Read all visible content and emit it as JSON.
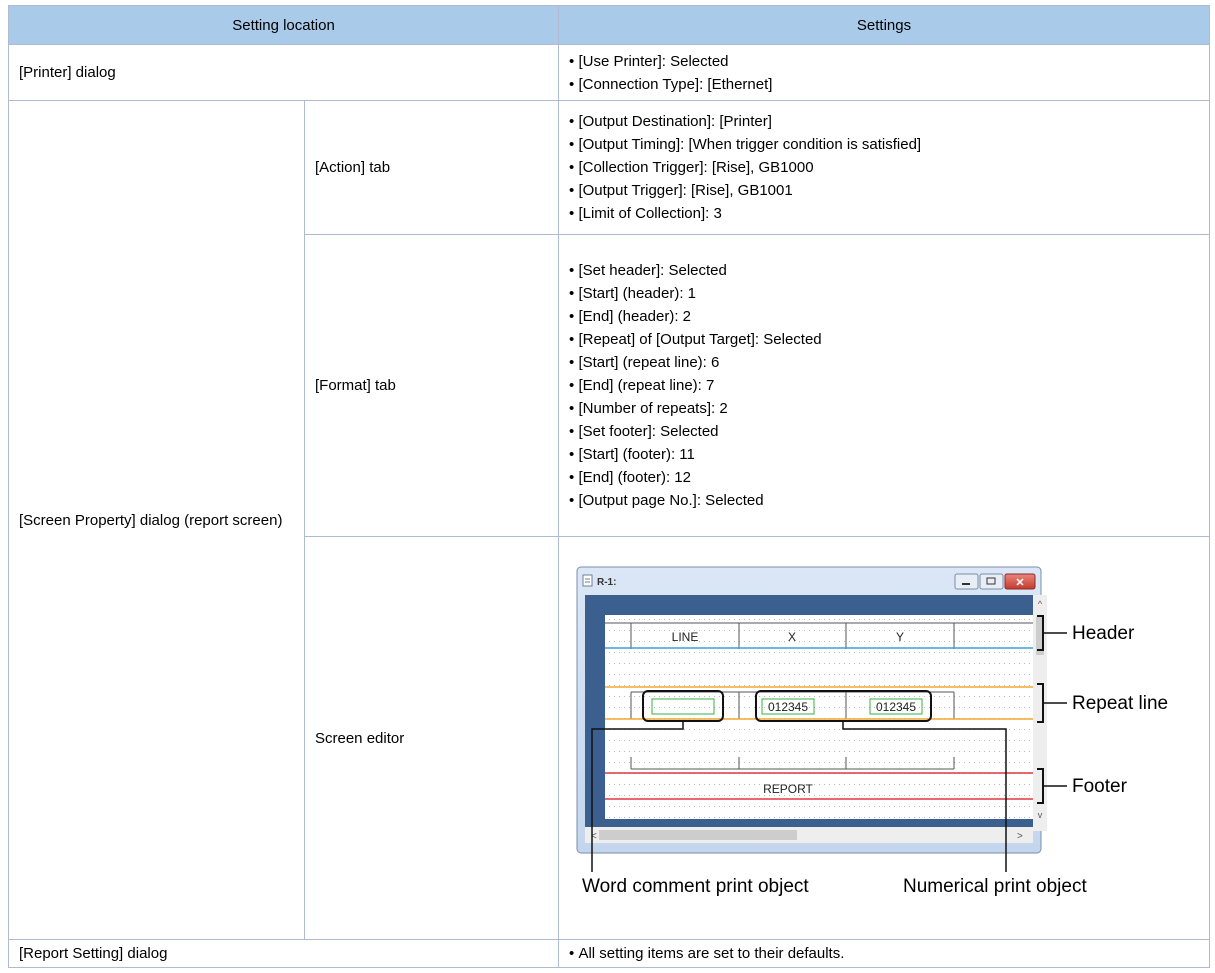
{
  "headers": {
    "location": "Setting location",
    "settings": "Settings"
  },
  "printer_row": {
    "location": "[Printer] dialog",
    "settings": [
      "[Use Printer]: Selected",
      "[Connection Type]: [Ethernet]"
    ]
  },
  "screen_property": {
    "location": "[Screen Property] dialog (report screen)",
    "action_tab": {
      "label": "[Action] tab",
      "settings": [
        "[Output Destination]: [Printer]",
        "[Output Timing]: [When trigger condition is satisfied]",
        "[Collection Trigger]: [Rise], GB1000",
        "[Output Trigger]: [Rise], GB1001",
        "[Limit of Collection]: 3"
      ]
    },
    "format_tab": {
      "label": "[Format] tab",
      "settings": [
        "[Set header]: Selected",
        "[Start] (header): 1",
        "[End] (header): 2",
        "[Repeat] of [Output Target]: Selected",
        "[Start] (repeat line): 6",
        "[End] (repeat line): 7",
        "[Number of repeats]: 2",
        "[Set footer]: Selected",
        "[Start] (footer): 11",
        "[End] (footer): 12",
        "[Output page No.]: Selected"
      ]
    },
    "screen_editor": {
      "label": "Screen editor",
      "window_title": "R-1:",
      "columns": [
        "LINE",
        "X",
        "Y"
      ],
      "numeric_sample_1": "012345",
      "numeric_sample_2": "012345",
      "footer_text": "REPORT",
      "callout_header": "Header",
      "callout_repeat": "Repeat line",
      "callout_footer": "Footer",
      "callout_word_comment": "Word comment print object",
      "callout_numerical": "Numerical print object"
    }
  },
  "report_row": {
    "location": "[Report Setting] dialog",
    "settings": [
      "All setting items are set to their defaults."
    ]
  },
  "colors": {
    "header_bg": "#a9cbe9",
    "window_frame": "#cbdbef",
    "close_button": "#c8453b",
    "header_line": "#3f9fd6",
    "repeat_line": "#f0a830",
    "footer_line": "#e2383f",
    "object_green": "#3cb043"
  }
}
